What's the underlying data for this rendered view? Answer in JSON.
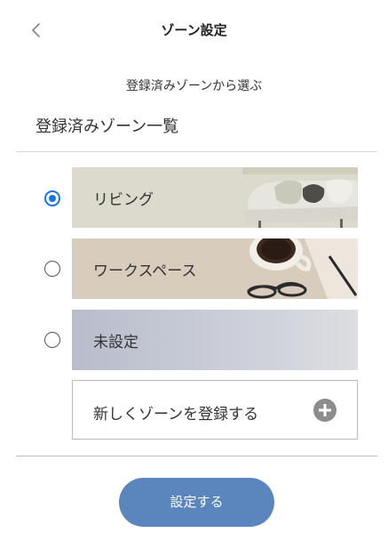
{
  "header": {
    "title": "ゾーン設定",
    "back_icon": "chevron-left-icon"
  },
  "subtitle": "登録済みゾーンから選ぶ",
  "section_title": "登録済みゾーン一覧",
  "zones": [
    {
      "label": "リビング",
      "selected": true,
      "image": "sofa-with-pillows"
    },
    {
      "label": "ワークスペース",
      "selected": false,
      "image": "coffee-cup-glasses-pen"
    },
    {
      "label": "未設定",
      "selected": false,
      "image": "none"
    }
  ],
  "register": {
    "label": "新しくゾーンを登録する",
    "icon": "plus-circle-icon"
  },
  "submit": {
    "label": "設定する"
  },
  "colors": {
    "accent": "#5b86bd",
    "radio_selected": "#1a73e8",
    "living_bg": "#dcdacc",
    "workspace_bg": "#d8ccbd",
    "unset_bg": "#b8bdcc"
  }
}
